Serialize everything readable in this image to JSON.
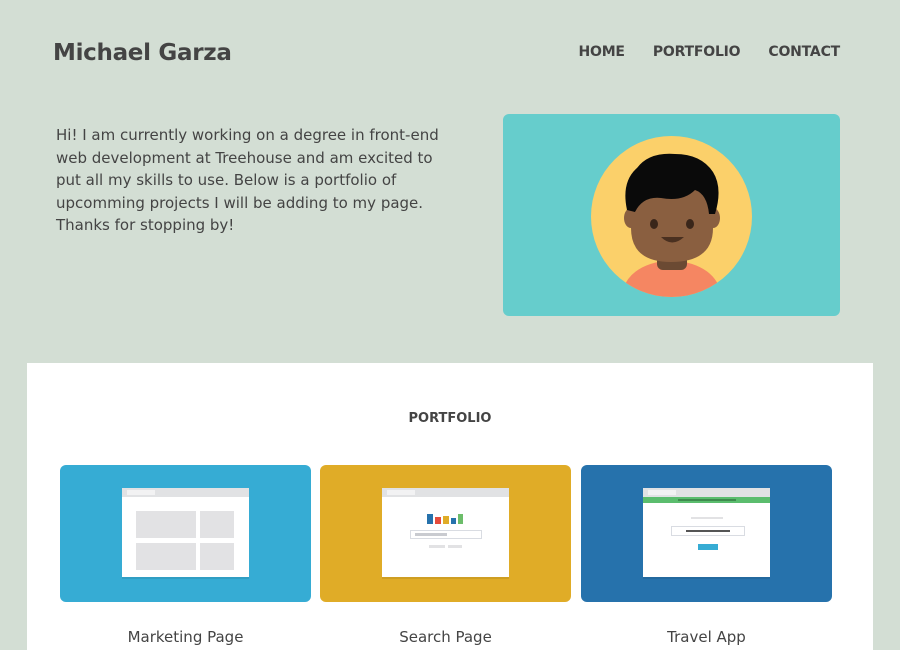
{
  "header": {
    "site_title": "Michael Garza",
    "nav": [
      "HOME",
      "PORTFOLIO",
      "CONTACT"
    ]
  },
  "intro": {
    "text": "Hi! I am currently working on a degree in front-end web development at Treehouse and am excited to put all my skills to use. Below is a portfolio of upcomming projects I will be adding to my page. Thanks for stopping by!"
  },
  "hero": {
    "background": "#66cdcc",
    "avatar_bg": "#fbd06a",
    "icon": "avatar-illustration"
  },
  "portfolio": {
    "heading": "PORTFOLIO",
    "items": [
      {
        "label": "Marketing Page",
        "color": "#36acd4",
        "icon": "marketing-page-thumbnail"
      },
      {
        "label": "Search Page",
        "color": "#e0ac27",
        "icon": "search-page-thumbnail"
      },
      {
        "label": "Travel App",
        "color": "#2672ac",
        "icon": "travel-app-thumbnail"
      }
    ]
  }
}
